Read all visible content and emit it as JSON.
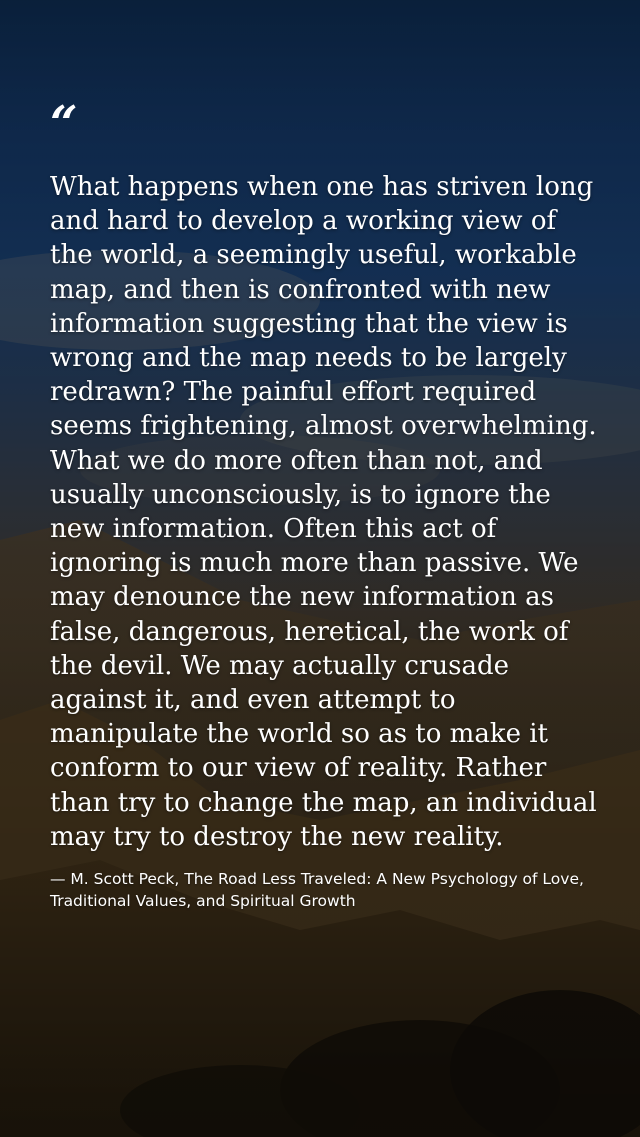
{
  "quote": {
    "mark": "“",
    "text": "What happens when one has striven long and hard to develop a working view of the world, a seemingly useful, workable map, and then is confronted with new information suggesting that the view is wrong and the map needs to be largely redrawn? The painful effort required seems frightening, almost overwhelming. What we do more often than not, and usually unconsciously, is to ignore the new information. Often this act of ignoring is much more than passive. We may denounce the new information as false, dangerous, heretical, the work of the devil. We may actually crusade against it, and even attempt to manipulate the world so as to make it conform to our view of reality. Rather than try to change the map, an individual may try to destroy the new reality.",
    "attribution": "— M. Scott Peck, The Road Less Traveled: A New Psychology of Love, Traditional Values, and Spiritual Growth"
  },
  "colors": {
    "sky_top": "#0d2a4e",
    "hills": "#3a2d18",
    "text": "#ffffff"
  },
  "background": {
    "description_icon": "mountain-landscape-photo"
  }
}
